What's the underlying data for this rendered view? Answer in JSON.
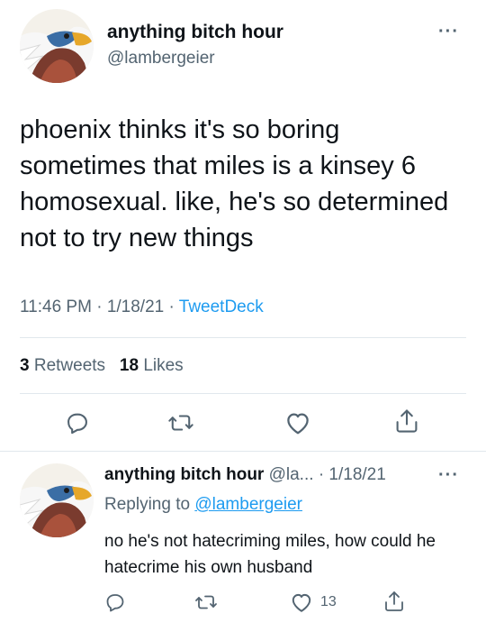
{
  "main_tweet": {
    "author_name": "anything bitch hour",
    "handle": "@lambergeier",
    "text": "phoenix thinks it's so boring sometimes that miles is a kinsey 6 homosexual. like, he's so determined not to try new things",
    "time": "11:46 PM",
    "date": "1/18/21",
    "separator": "·",
    "source": "TweetDeck",
    "retweets_count": "3",
    "retweets_label": "Retweets",
    "likes_count": "18",
    "likes_label": "Likes",
    "more_label": "···"
  },
  "reply_tweet": {
    "author_name": "anything bitch hour",
    "handle_truncated": "@la...",
    "separator": "·",
    "date": "1/18/21",
    "replying_to_label": "Replying to",
    "replying_to_handle": "@lambergeier",
    "text": "no he's not hatecriming miles, how could he hatecrime his own husband",
    "like_count": "13",
    "more_label": "···"
  },
  "icons": [
    "reply-icon",
    "retweet-icon",
    "like-icon",
    "share-icon",
    "more-icon",
    "avatar-bird"
  ],
  "colors": {
    "link_blue": "#1d9bf0",
    "muted_gray": "#536471",
    "text_black": "#0f1419",
    "divider": "#e1e8ed"
  }
}
